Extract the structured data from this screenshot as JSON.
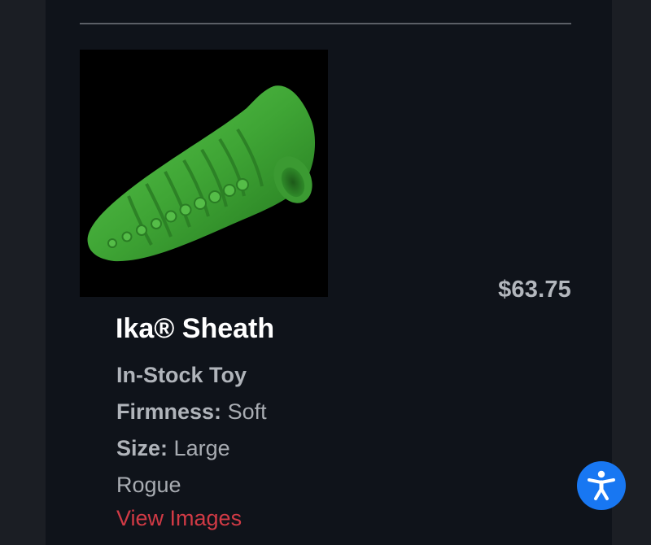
{
  "product": {
    "image_alt": "Ika® Sheath",
    "title": "Ika® Sheath",
    "price": "$63.75",
    "stock": "In-Stock Toy",
    "firmness_label": "Firmness:",
    "firmness_value": "Soft",
    "size_label": "Size:",
    "size_value": "Large",
    "brand": "Rogue",
    "view_images_label": "View Images"
  },
  "accessibility": {
    "icon": "accessibility-person-icon",
    "color": "#1877f2"
  },
  "colors": {
    "background": "#0f131a",
    "link": "#d03a45",
    "price": "#b3b7bd",
    "product_green": "#3fa535"
  }
}
